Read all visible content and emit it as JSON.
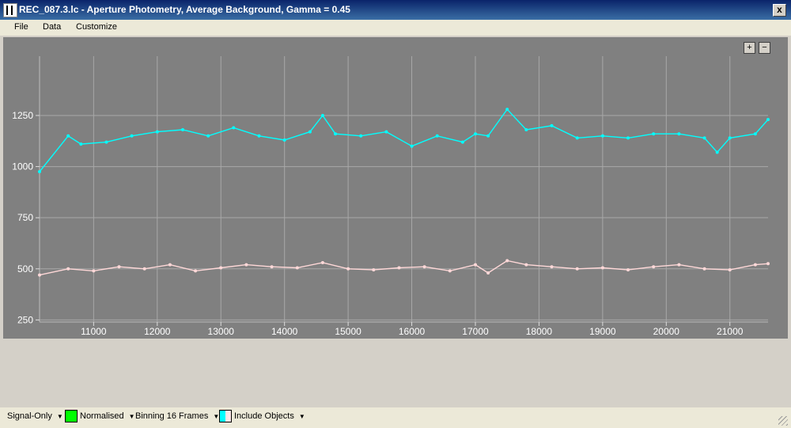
{
  "window": {
    "title": "REC_087.3.lc - Aperture Photometry, Average Background, Gamma = 0.45",
    "close_label": "x"
  },
  "menu": [
    {
      "label": "File"
    },
    {
      "label": "Data"
    },
    {
      "label": "Customize"
    }
  ],
  "zoom": {
    "in_label": "+",
    "out_label": "−"
  },
  "statusbar": {
    "signal_mode": "Signal-Only",
    "normalised": "Normalised",
    "binning": "Binning 16 Frames",
    "include_objects": "Include Objects",
    "normalised_color": "#00ff00",
    "objects_color_1": "#00ffff",
    "objects_color_2": "#ffe8e8"
  },
  "chart_data": {
    "type": "line",
    "xlim": [
      10150,
      21600
    ],
    "ylim": [
      240,
      1540
    ],
    "x_ticks": [
      11000,
      12000,
      13000,
      14000,
      15000,
      16000,
      17000,
      18000,
      19000,
      20000,
      21000
    ],
    "y_ticks": [
      250,
      500,
      750,
      1000,
      1250
    ],
    "grid": true,
    "series": [
      {
        "color": "#00ffff",
        "points": [
          [
            10150,
            975
          ],
          [
            10600,
            1150
          ],
          [
            10800,
            1110
          ],
          [
            11200,
            1120
          ],
          [
            11600,
            1150
          ],
          [
            12000,
            1170
          ],
          [
            12400,
            1180
          ],
          [
            12800,
            1150
          ],
          [
            13200,
            1190
          ],
          [
            13600,
            1150
          ],
          [
            14000,
            1130
          ],
          [
            14400,
            1170
          ],
          [
            14600,
            1250
          ],
          [
            14800,
            1160
          ],
          [
            15200,
            1150
          ],
          [
            15600,
            1170
          ],
          [
            16000,
            1100
          ],
          [
            16400,
            1150
          ],
          [
            16800,
            1120
          ],
          [
            17000,
            1160
          ],
          [
            17200,
            1150
          ],
          [
            17500,
            1280
          ],
          [
            17800,
            1180
          ],
          [
            18200,
            1200
          ],
          [
            18600,
            1140
          ],
          [
            19000,
            1150
          ],
          [
            19400,
            1140
          ],
          [
            19800,
            1160
          ],
          [
            20200,
            1160
          ],
          [
            20600,
            1140
          ],
          [
            20800,
            1070
          ],
          [
            21000,
            1140
          ],
          [
            21400,
            1160
          ],
          [
            21600,
            1230
          ]
        ]
      },
      {
        "color": "#ffd8d8",
        "points": [
          [
            10150,
            470
          ],
          [
            10600,
            500
          ],
          [
            11000,
            490
          ],
          [
            11400,
            510
          ],
          [
            11800,
            500
          ],
          [
            12200,
            520
          ],
          [
            12600,
            490
          ],
          [
            13000,
            505
          ],
          [
            13400,
            520
          ],
          [
            13800,
            510
          ],
          [
            14200,
            505
          ],
          [
            14600,
            530
          ],
          [
            15000,
            500
          ],
          [
            15400,
            495
          ],
          [
            15800,
            505
          ],
          [
            16200,
            510
          ],
          [
            16600,
            490
          ],
          [
            17000,
            520
          ],
          [
            17200,
            480
          ],
          [
            17500,
            540
          ],
          [
            17800,
            520
          ],
          [
            18200,
            510
          ],
          [
            18600,
            500
          ],
          [
            19000,
            505
          ],
          [
            19400,
            495
          ],
          [
            19800,
            510
          ],
          [
            20200,
            520
          ],
          [
            20600,
            500
          ],
          [
            21000,
            495
          ],
          [
            21400,
            520
          ],
          [
            21600,
            525
          ]
        ]
      }
    ]
  }
}
